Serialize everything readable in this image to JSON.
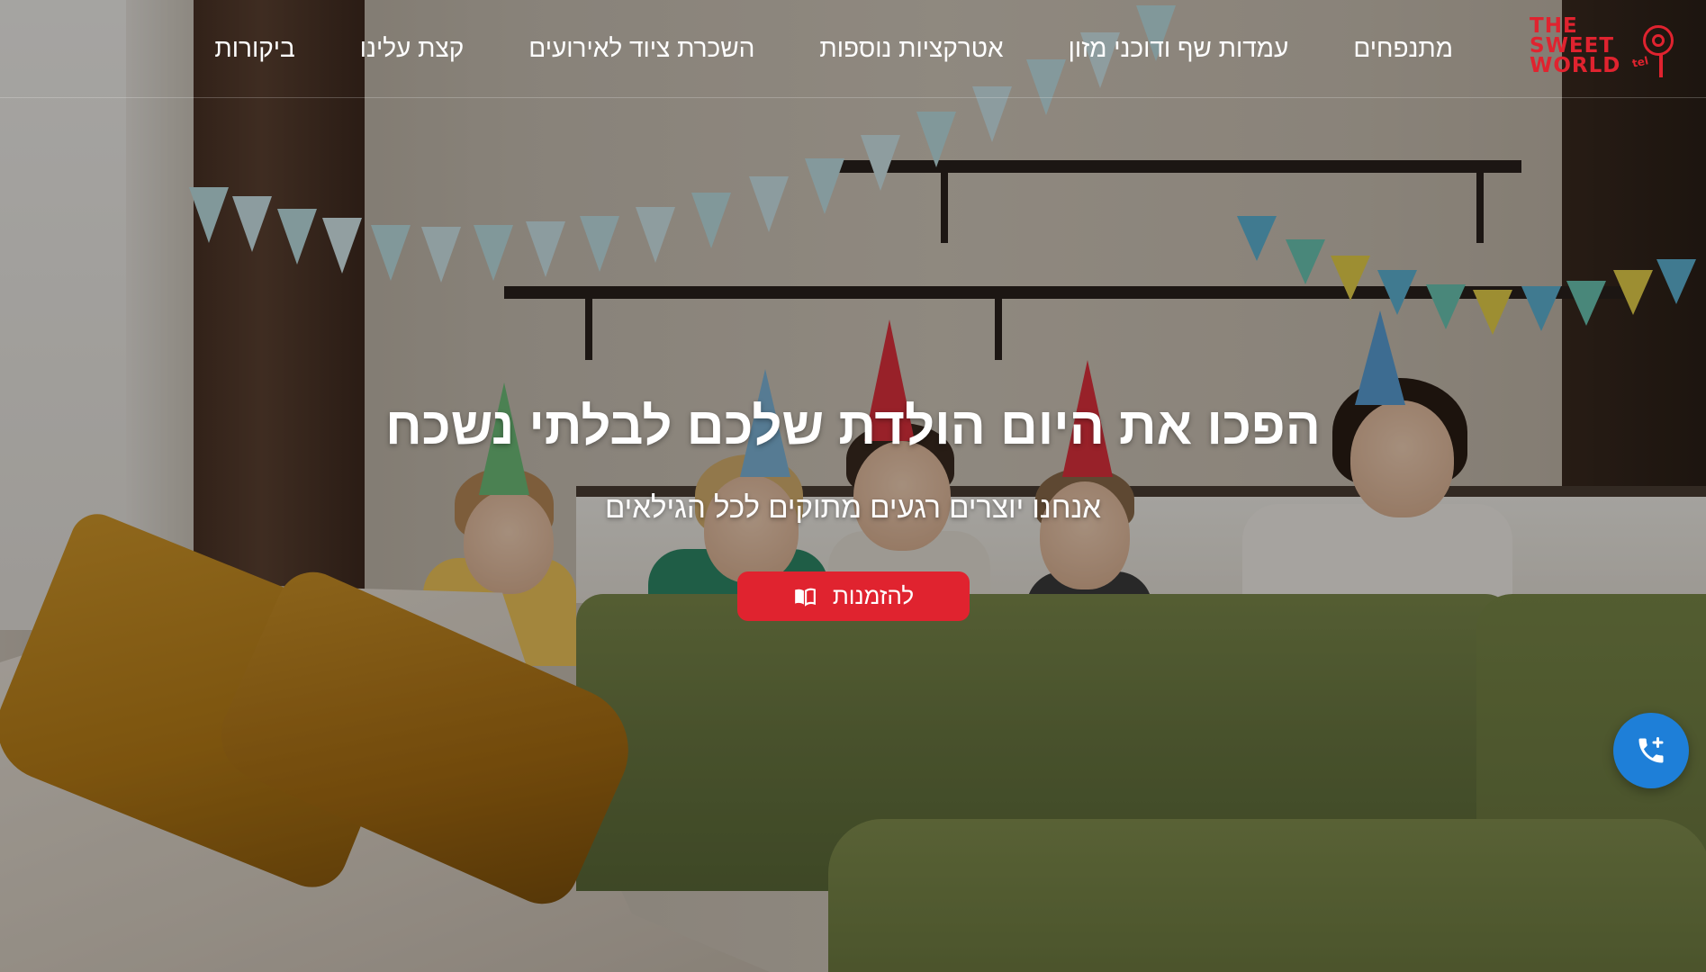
{
  "header": {
    "logo": {
      "line1": "THE",
      "line2": "SWEET",
      "line3": "WORLD",
      "badge": "tel"
    },
    "nav": [
      {
        "label": "מתנפחים"
      },
      {
        "label": "עמדות שף ודוכני מזון"
      },
      {
        "label": "אטרקציות נוספות"
      },
      {
        "label": "השכרת ציוד לאירועים"
      },
      {
        "label": "קצת עלינו"
      },
      {
        "label": "ביקורות"
      }
    ]
  },
  "hero": {
    "title": "הפכו את היום הולדת שלכם לבלתי נשכח",
    "subtitle": "אנחנו יוצרים רגעים מתוקים לכל הגילאים",
    "cta": {
      "label": "להזמנות",
      "icon": "book-open-icon"
    }
  },
  "floating": {
    "call_icon": "phone-add-icon"
  },
  "colors": {
    "brand_red": "#e0232f",
    "call_blue": "#1e7fd8",
    "text": "#ffffff"
  }
}
